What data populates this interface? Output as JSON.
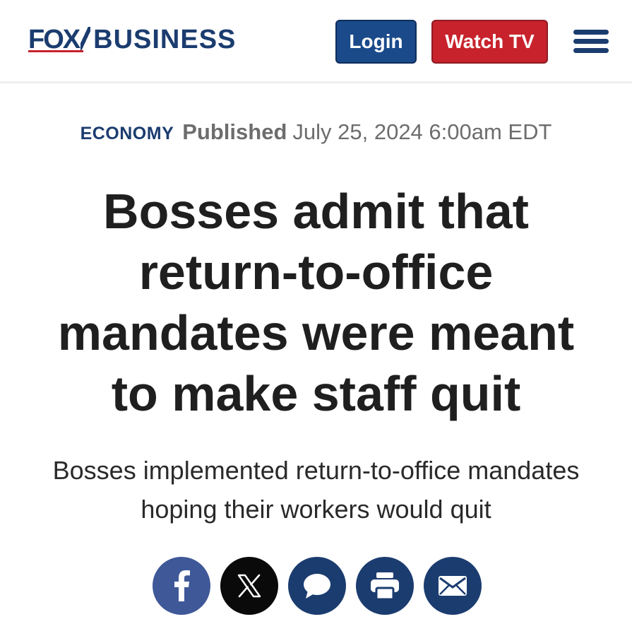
{
  "header": {
    "logo": {
      "brand_fox": "FOX",
      "brand_business": "BUSINESS"
    },
    "login_label": "Login",
    "watch_tv_label": "Watch TV",
    "menu_icon": "hamburger-menu-icon"
  },
  "article": {
    "category": "ECONOMY",
    "published_label": "Published",
    "published_date": "July 25, 2024 6:00am EDT",
    "headline": "Bosses admit that return-to-office mandates were meant to make staff quit",
    "subheadline": "Bosses implemented return-to-office mandates hoping their workers would quit"
  },
  "share": {
    "icons": [
      "facebook-icon",
      "x-icon",
      "comment-icon",
      "print-icon",
      "email-icon"
    ]
  },
  "colors": {
    "brand_navy": "#1a3c6e",
    "login_blue": "#1a4a8a",
    "watch_red": "#c8232c",
    "facebook_blue": "#3f5897",
    "x_black": "#0a0a0a",
    "meta_gray": "#6d6d6d",
    "headline": "#1f1f1f"
  }
}
